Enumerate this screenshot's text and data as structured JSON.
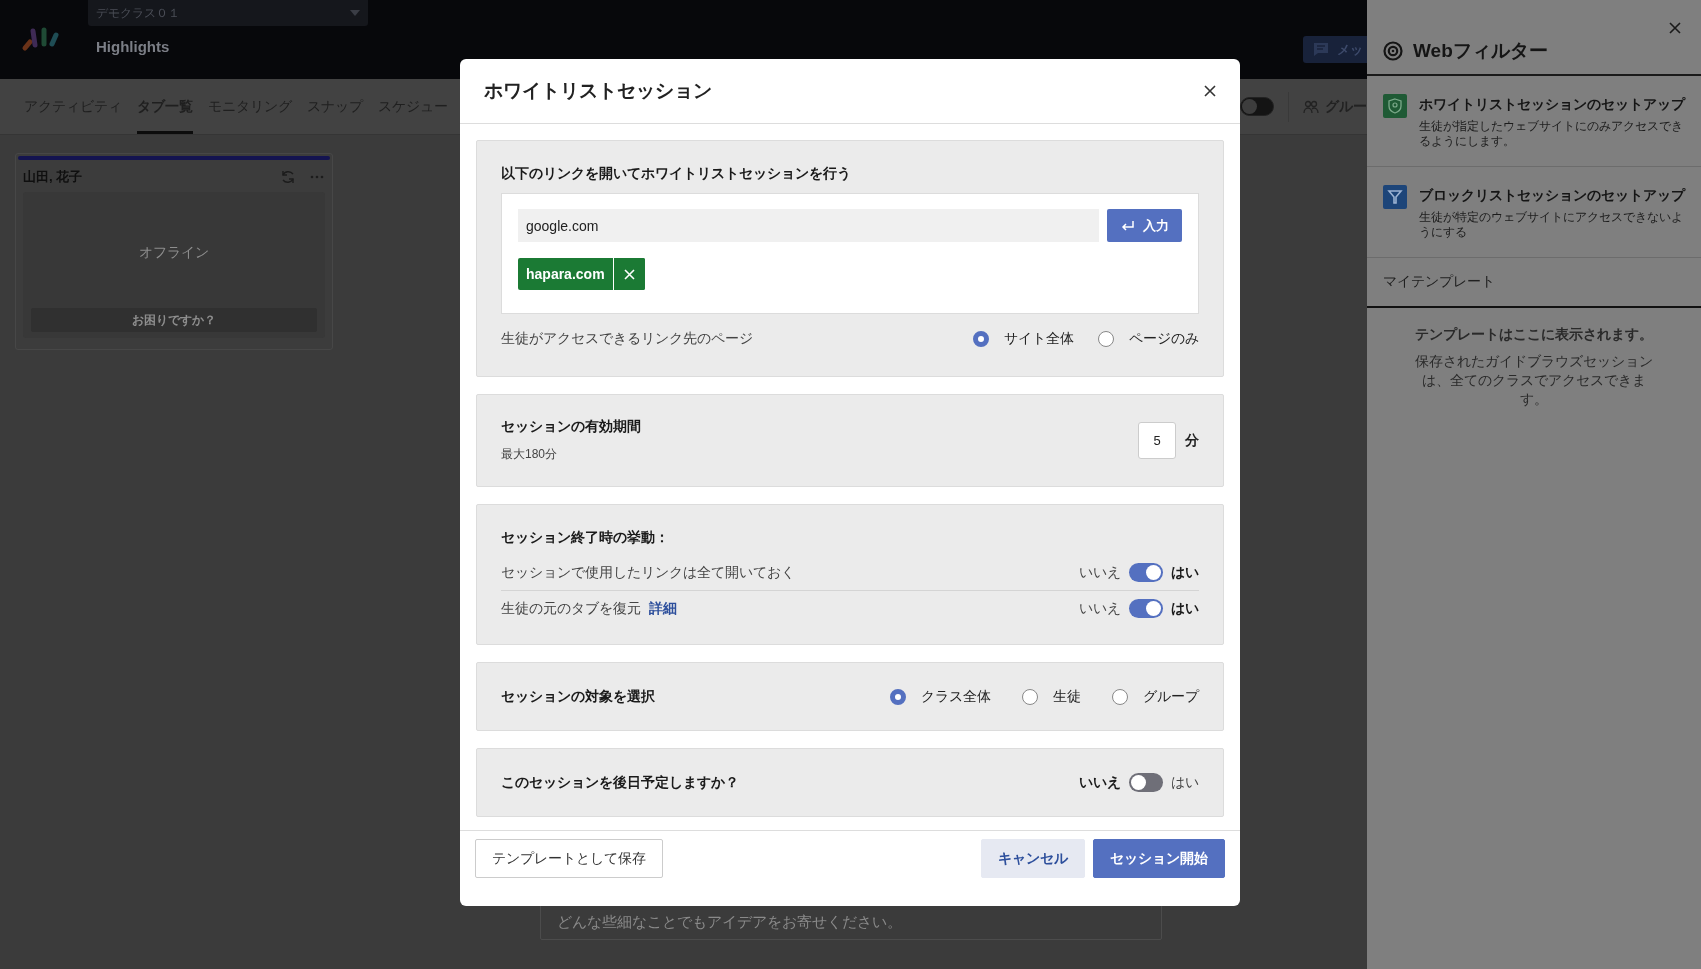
{
  "header": {
    "class_selector": "デモクラス０１",
    "title": "Highlights",
    "message_button": "メッ"
  },
  "nav": {
    "tabs": [
      {
        "label": "アクティビティ",
        "selected": false
      },
      {
        "label": "タブ一覧",
        "selected": true
      },
      {
        "label": "モニタリング",
        "selected": false
      },
      {
        "label": "スナップ",
        "selected": false
      },
      {
        "label": "スケジュー",
        "selected": false
      }
    ],
    "toggle": {
      "on": false
    },
    "group_button": "グルー"
  },
  "student_cards": [
    {
      "name": "山田, 花子",
      "status": "オフライン",
      "help_button": "お困りですか？"
    }
  ],
  "feedback_field": {
    "placeholder": "どんな些細なことでもアイデアをお寄せください。"
  },
  "modal": {
    "title": "ホワイトリストセッション",
    "link_section": {
      "heading": "以下のリンクを開いてホワイトリストセッションを行う",
      "url_field": {
        "value": "google.com"
      },
      "enter_button": "入力",
      "tags": [
        {
          "label": "hapara.com"
        }
      ],
      "access_label": "生徒がアクセスできるリンク先のページ",
      "access_options": [
        {
          "label": "サイト全体",
          "selected": true
        },
        {
          "label": "ページのみ",
          "selected": false
        }
      ]
    },
    "duration": {
      "heading": "セッションの有効期間",
      "note": "最大180分",
      "value": "5",
      "unit": "分"
    },
    "end_behavior": {
      "heading": "セッション終了時の挙動：",
      "rows": [
        {
          "label": "セッションで使用したリンクは全て開いておく",
          "off_label": "いいえ",
          "on_label": "はい",
          "on": true
        },
        {
          "label": "生徒の元のタブを復元",
          "link": "詳細",
          "off_label": "いいえ",
          "on_label": "はい",
          "on": true
        }
      ]
    },
    "target": {
      "heading": "セッションの対象を選択",
      "options": [
        {
          "label": "クラス全体",
          "selected": true
        },
        {
          "label": "生徒",
          "selected": false
        },
        {
          "label": "グループ",
          "selected": false
        }
      ]
    },
    "schedule": {
      "heading": "このセッションを後日予定しますか？",
      "off_label": "いいえ",
      "on_label": "はい",
      "on": false
    },
    "buttons": {
      "save_template": "テンプレートとして保存",
      "cancel": "キャンセル",
      "start": "セッション開始"
    }
  },
  "sidebar": {
    "title": "Webフィルター",
    "items": [
      {
        "kind": "allowlist",
        "title": "ホワイトリストセッションのセットアップ",
        "description": "生徒が指定したウェブサイトにのみアクセスできるようにします。"
      },
      {
        "kind": "blocklist",
        "title": "ブロックリストセッションのセットアップ",
        "description": "生徒が特定のウェブサイトにアクセスできないようにする"
      }
    ],
    "templates_heading": "マイテンプレート",
    "empty_title": "テンプレートはここに表示されます。",
    "empty_text": "保存されたガイドブラウズセッションは、全てのクラスでアクセスできます。"
  }
}
